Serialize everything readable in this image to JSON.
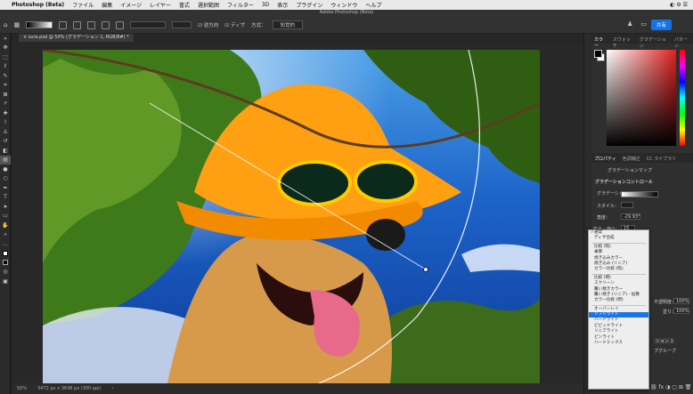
{
  "menubar": {
    "app": "Photoshop (Beta)",
    "items": [
      "ファイル",
      "編集",
      "イメージ",
      "レイヤー",
      "書式",
      "選択範囲",
      "フィルター",
      "3D",
      "表示",
      "プラグイン",
      "ウィンドウ",
      "ヘルプ"
    ]
  },
  "window_title": "Adobe Photoshop (Beta)",
  "options": {
    "checkbox1": "逆方向",
    "checkbox2": "ディザ",
    "method_label": "方式：",
    "method_value": "知覚的",
    "share": "共有"
  },
  "document_tab": "sora.psd @ 50% (グラデーション 1, RGB/8#) *",
  "status": {
    "zoom": "50%",
    "size": "3472 px x 3648 px (300 ppi)"
  },
  "panel_tabs_top": [
    "カラー",
    "スウォッチ",
    "グラデーション",
    "パターン"
  ],
  "panel_tabs_mid": [
    "プロパティ",
    "色調補正",
    "CC ライブラリ"
  ],
  "props": {
    "title": "グラデーションマップ",
    "section": "グラデーションコントロール",
    "gradient_label": "グラデーション：",
    "style_label": "スタイル：",
    "angle_label": "角度：",
    "angle_value": "-29.93°",
    "scale_label": "拡大・縮小：",
    "scale_value": "15",
    "opacity_label": "不透明度：",
    "opacity_value": "100%",
    "fill_label": "塗り：",
    "fill_value": "100%",
    "layer_name": "ション 1",
    "group_label": "プグループ"
  },
  "blend_menu": {
    "selected": "ソフトライト",
    "groups": [
      [
        "通常",
        "ディザ合成"
      ],
      [
        "比較 (暗)",
        "乗算",
        "焼き込みカラー",
        "焼き込み (リニア)",
        "カラー比較 (暗)"
      ],
      [
        "比較 (明)",
        "スクリーン",
        "覆い焼きカラー",
        "覆い焼き (リニア) - 加算",
        "カラー比較 (明)"
      ],
      [
        "オーバーレイ",
        "ソフトライト",
        "ハードライト",
        "ビビッドライト",
        "リニアライト",
        "ピンライト",
        "ハードミックス"
      ]
    ]
  },
  "colors": {
    "accent": "#1473e6",
    "menu_sel": "#1a73e8"
  }
}
